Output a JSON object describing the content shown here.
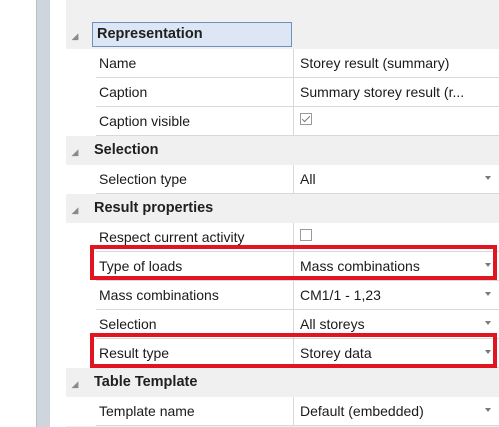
{
  "categories": {
    "representation": {
      "label": "Representation",
      "rows": [
        {
          "name": "Name",
          "value": "Storey result (summary)"
        },
        {
          "name": "Caption",
          "value": "Summary storey result (r..."
        },
        {
          "name": "Caption visible",
          "checked": true
        }
      ]
    },
    "selection": {
      "label": "Selection",
      "rows": [
        {
          "name": "Selection type",
          "value": "All"
        }
      ]
    },
    "result_properties": {
      "label": "Result properties",
      "rows": [
        {
          "name": "Respect current activity",
          "checked": false
        },
        {
          "name": "Type of loads",
          "value": "Mass combinations"
        },
        {
          "name": "Mass combinations",
          "value": "CM1/1 - 1,23"
        },
        {
          "name": "Selection",
          "value": "All storeys"
        },
        {
          "name": "Result type",
          "value": "Storey data"
        }
      ]
    },
    "table_template": {
      "label": "Table Template",
      "rows": [
        {
          "name": "Template name",
          "value": "Default (embedded)"
        }
      ]
    }
  },
  "highlight_color": "#e0151f"
}
